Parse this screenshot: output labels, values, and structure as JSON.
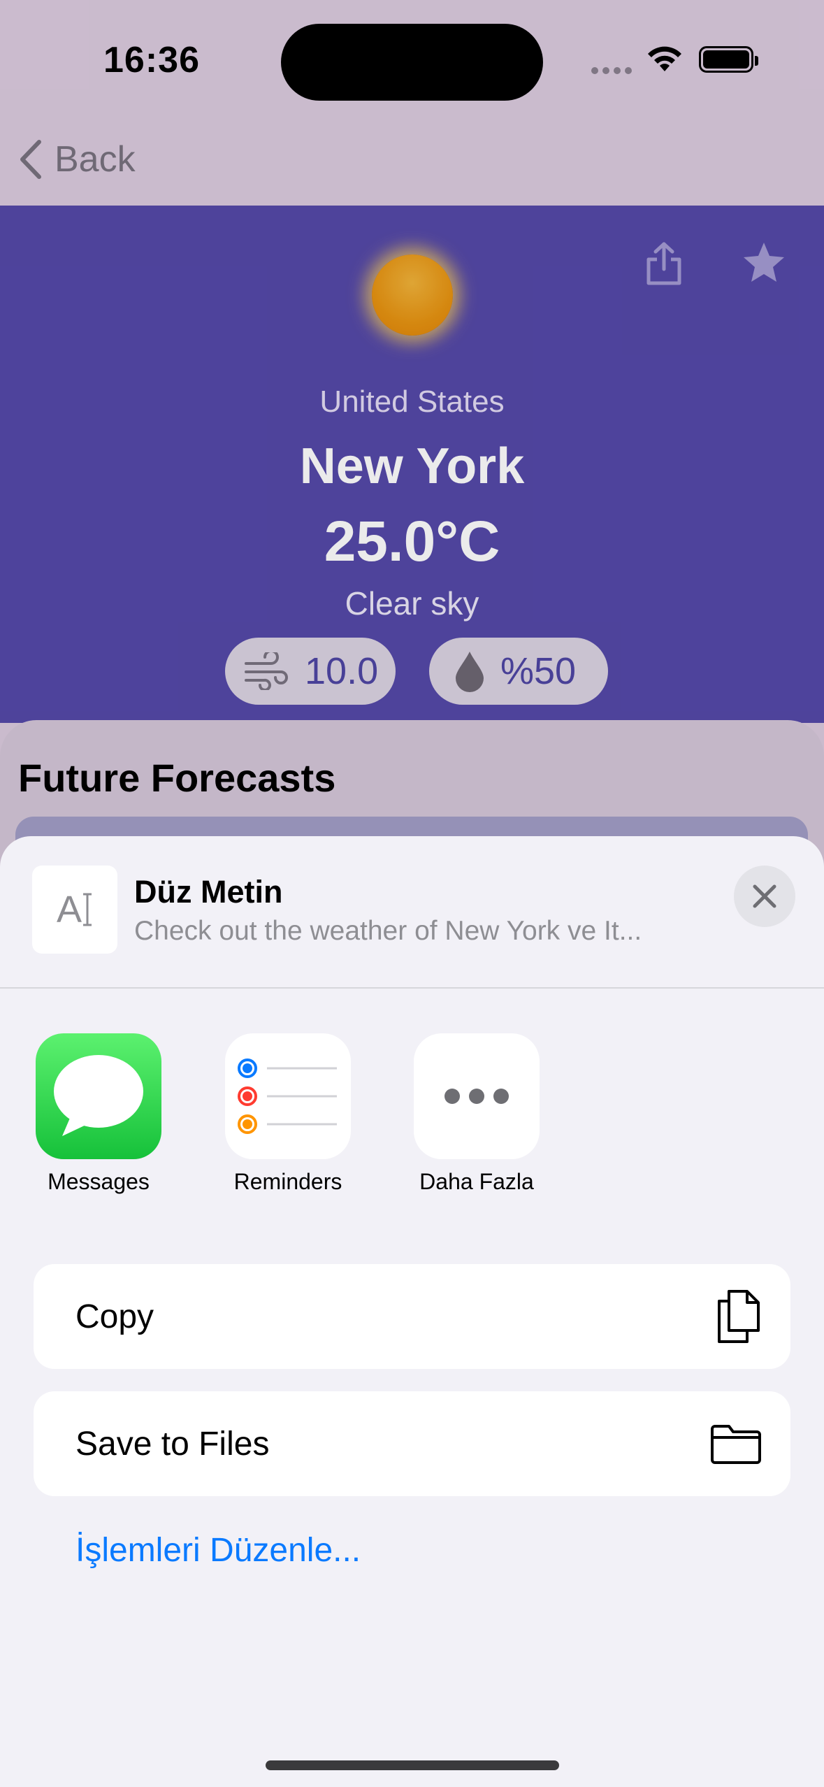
{
  "status_bar": {
    "time": "16:36"
  },
  "nav": {
    "back_label": "Back"
  },
  "weather": {
    "country": "United States",
    "city": "New York",
    "temperature": "25.0°C",
    "condition": "Clear sky",
    "wind": "10.0",
    "humidity": "%50"
  },
  "forecast": {
    "title": "Future Forecasts"
  },
  "share_sheet": {
    "thumb_glyph": "A",
    "title": "Düz Metin",
    "subtitle": "Check out the weather of New York ve It...",
    "apps": [
      {
        "label": "Messages",
        "icon": "messages-icon"
      },
      {
        "label": "Reminders",
        "icon": "reminders-icon"
      },
      {
        "label": "Daha Fazla",
        "icon": "more-icon"
      }
    ],
    "actions": [
      {
        "label": "Copy",
        "icon": "copy-icon"
      },
      {
        "label": "Save to Files",
        "icon": "folder-icon"
      }
    ],
    "edit_actions": "İşlemleri Düzenle..."
  },
  "colors": {
    "header_bg": "#5549a9",
    "page_bg": "#dccbdf",
    "sheet_bg": "#f2f1f7",
    "link": "#0a7aff",
    "messages_green": "#16c13a"
  }
}
